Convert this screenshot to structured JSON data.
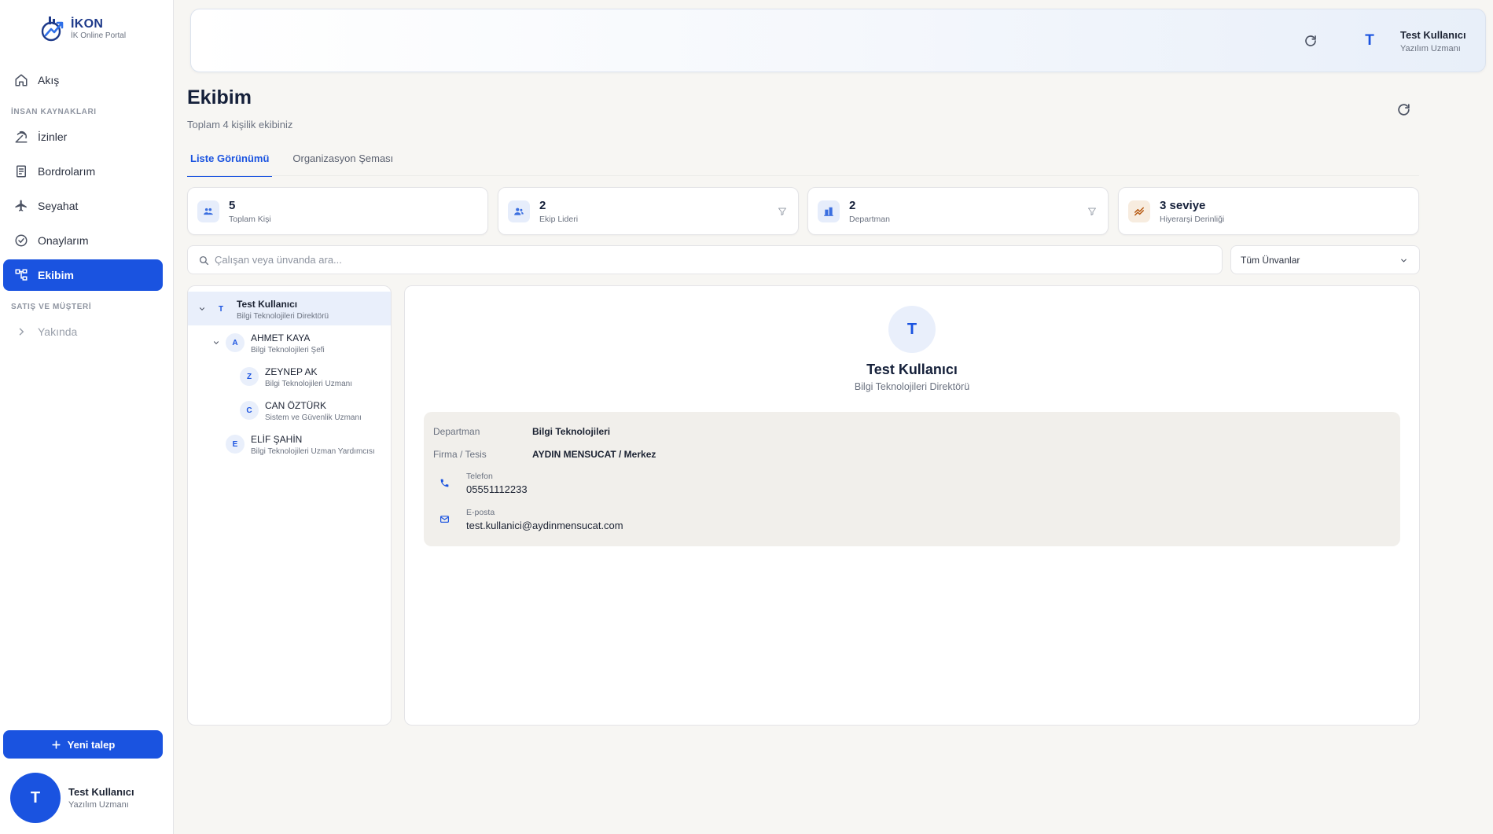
{
  "brand": {
    "name": "İKON",
    "subtitle": "İK Online Portal"
  },
  "sidebar": {
    "items": [
      {
        "label": "Akış",
        "icon": "home-icon"
      },
      {
        "label": "İzinler",
        "icon": "beach-icon"
      },
      {
        "label": "Bordrolarım",
        "icon": "receipt-icon"
      },
      {
        "label": "Seyahat",
        "icon": "plane-icon"
      },
      {
        "label": "Onaylarım",
        "icon": "check-circle-icon"
      },
      {
        "label": "Ekibim",
        "icon": "org-chart-icon",
        "active": true
      },
      {
        "label": "Yakında",
        "icon": "chevron-right-icon",
        "disabled": true
      }
    ],
    "sections": {
      "hr": "İNSAN KAYNAKLARI",
      "sales": "SATIŞ VE MÜŞTERİ"
    },
    "new_request": "Yeni talep",
    "user": {
      "initial": "T",
      "name": "Test Kullanıcı",
      "role": "Yazılım Uzmanı"
    }
  },
  "header": {
    "user": {
      "initial": "T",
      "name": "Test Kullanıcı",
      "role": "Yazılım Uzmanı"
    }
  },
  "page": {
    "title": "Ekibim",
    "subtitle": "Toplam 4 kişilik ekibiniz",
    "tabs": [
      {
        "label": "Liste Görünümü",
        "active": true
      },
      {
        "label": "Organizasyon Şeması",
        "active": false
      }
    ]
  },
  "stats": [
    {
      "value": "5",
      "label": "Toplam Kişi",
      "icon": "users-icon",
      "color": "#3b6fe0",
      "bg": "#e6edfb"
    },
    {
      "value": "2",
      "label": "Ekip Lideri",
      "icon": "team-leader-icon",
      "color": "#3b6fe0",
      "bg": "#e6edfb"
    },
    {
      "value": "2",
      "label": "Departman",
      "icon": "building-icon",
      "color": "#3b6fe0",
      "bg": "#e6edfb"
    },
    {
      "value": "3 seviye",
      "label": "Hiyerarşi Derinliği",
      "icon": "hierarchy-icon",
      "color": "#b45309",
      "bg": "#f7ecdf"
    }
  ],
  "search": {
    "placeholder": "Çalışan veya ünvanda ara...",
    "value": ""
  },
  "filter": {
    "selected": "Tüm Ünvanlar"
  },
  "tree": [
    {
      "initial": "T",
      "name": "Test Kullanıcı",
      "role": "Bilgi Teknolojileri Direktörü",
      "selected": true,
      "expanded": true
    },
    {
      "initial": "A",
      "name": "AHMET KAYA",
      "role": "Bilgi Teknolojileri Şefi",
      "expanded": true
    },
    {
      "initial": "Z",
      "name": "ZEYNEP AK",
      "role": "Bilgi Teknolojileri Uzmanı"
    },
    {
      "initial": "C",
      "name": "CAN ÖZTÜRK",
      "role": "Sistem ve Güvenlik Uzmanı"
    },
    {
      "initial": "E",
      "name": "ELİF ŞAHİN",
      "role": "Bilgi Teknolojileri Uzman Yardımcısı"
    }
  ],
  "detail": {
    "initial": "T",
    "name": "Test Kullanıcı",
    "role": "Bilgi Teknolojileri Direktörü",
    "department_label": "Departman",
    "department": "Bilgi Teknolojileri",
    "company_label": "Firma / Tesis",
    "company": "AYDIN MENSUCAT / Merkez",
    "phone_label": "Telefon",
    "phone": "05551112233",
    "email_label": "E-posta",
    "email": "test.kullanici@aydinmensucat.com"
  }
}
